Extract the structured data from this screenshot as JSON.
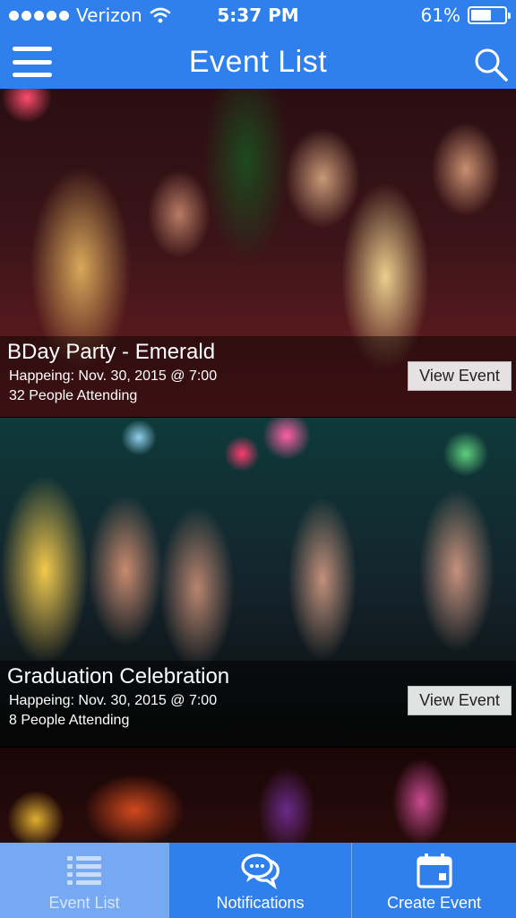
{
  "status_bar": {
    "carrier": "Verizon",
    "time": "5:37 PM",
    "battery_text": "61%",
    "battery_level": 0.61
  },
  "nav": {
    "title": "Event List",
    "menu_icon": "hamburger-menu-icon",
    "search_icon": "search-icon"
  },
  "events": [
    {
      "title": "BDay Party - Emerald",
      "when": "Happeing: Nov. 30, 2015 @ 7:00",
      "attending": "32 People Attending",
      "button": "View Event"
    },
    {
      "title": "Graduation Celebration",
      "when": "Happeing: Nov. 30, 2015 @ 7:00",
      "attending": "8 People Attending",
      "button": "View Event"
    }
  ],
  "tabs": [
    {
      "label": "Event List",
      "icon": "list-icon",
      "active": true
    },
    {
      "label": "Notifications",
      "icon": "chat-bubbles-icon",
      "active": false
    },
    {
      "label": "Create Event",
      "icon": "calendar-icon",
      "active": false
    }
  ],
  "colors": {
    "primary": "#2f80ec",
    "tab_active": "#77a8f2"
  }
}
